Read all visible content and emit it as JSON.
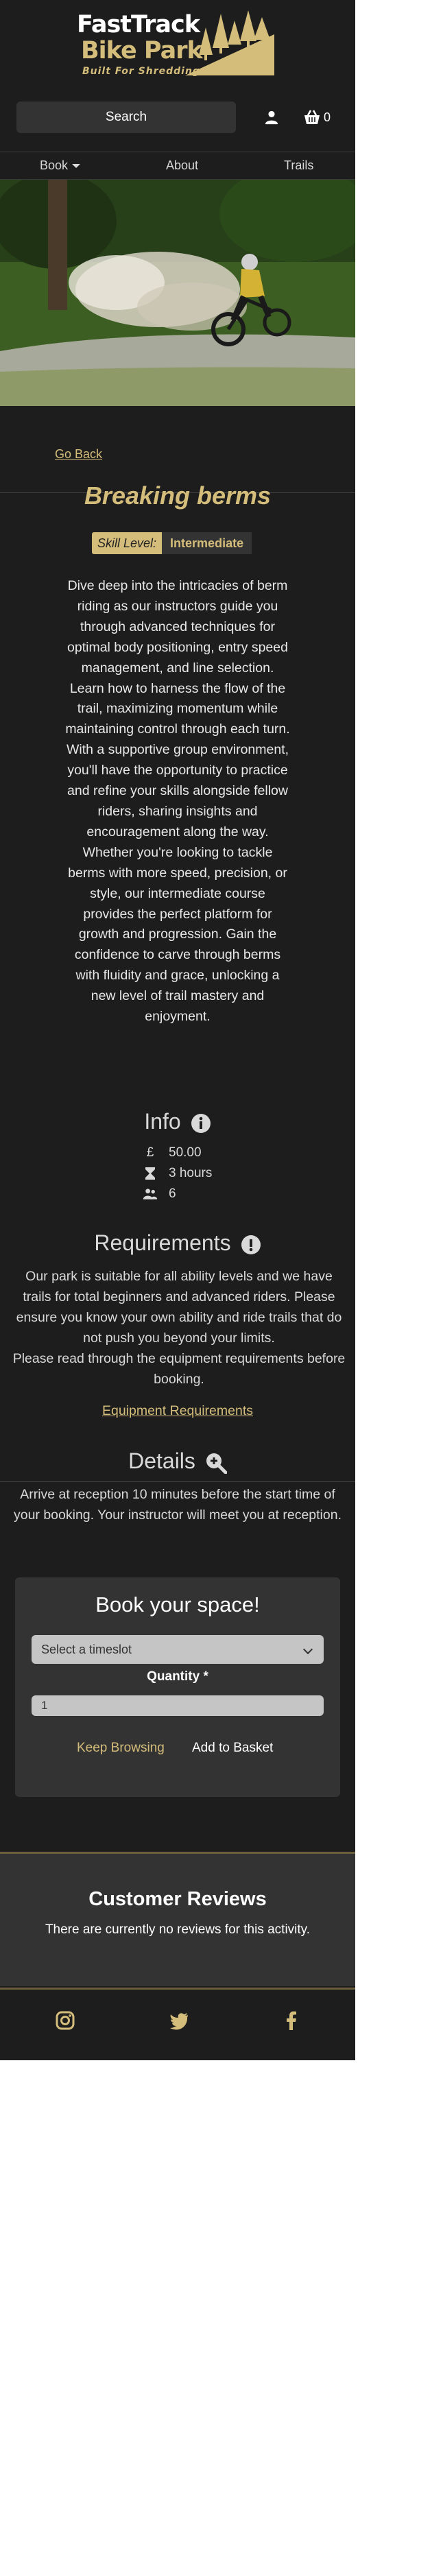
{
  "header": {
    "logo_line1": "FastTrack",
    "logo_line2": "Bike Park",
    "logo_tagline": "Built For Shredding",
    "search_label": "Search",
    "basket_count": "0"
  },
  "nav": {
    "book": "Book",
    "about": "About",
    "trails": "Trails"
  },
  "activity": {
    "go_back": "Go Back",
    "title": "Breaking berms",
    "skill_label": "Skill Level:",
    "skill_value": "Intermediate",
    "description": "Dive deep into the intricacies of berm riding as our instructors guide you through advanced techniques for optimal body positioning, entry speed management, and line selection. Learn how to harness the flow of the trail, maximizing momentum while maintaining control through each turn. With a supportive group environment, you'll have the opportunity to practice and refine your skills alongside fellow riders, sharing insights and encouragement along the way. Whether you're looking to tackle berms with more speed, precision, or style, our intermediate course provides the perfect platform for growth and progression. Gain the confidence to carve through berms with fluidity and grace, unlocking a new level of trail mastery and enjoyment."
  },
  "info": {
    "heading": "Info",
    "price": "50.00",
    "duration": "3 hours",
    "capacity": "6"
  },
  "requirements": {
    "heading": "Requirements",
    "text_1": "Our park is suitable for all ability levels and we have trails for total beginners and advanced riders. Please ensure you know your own ability and ride trails that do not push you beyond your limits.",
    "text_2": "Please read through the equipment requirements before booking.",
    "equipment_link": "Equipment Requirements"
  },
  "details": {
    "heading": "Details",
    "text": "Arrive at reception 10 minutes before the start time of your booking. Your instructor will meet you at reception."
  },
  "booking": {
    "title": "Book your space!",
    "timeslot_placeholder": "Select a timeslot",
    "quantity_label": "Quantity *",
    "quantity_value": "1",
    "keep_browsing": "Keep Browsing",
    "add_to_basket": "Add to Basket"
  },
  "reviews": {
    "title": "Customer Reviews",
    "empty_text": "There are currently no reviews for this activity."
  },
  "colors": {
    "background": "#1d1d1d",
    "accent_gold": "#d4bd7a",
    "card": "#333333"
  },
  "icons": {
    "user": "user-icon",
    "basket": "basket-icon",
    "info": "info-icon",
    "pound": "pound-icon",
    "hourglass": "hourglass-icon",
    "people": "people-icon",
    "exclamation": "exclamation-icon",
    "magnify_plus": "zoom-in-icon",
    "instagram": "instagram-icon",
    "twitter": "twitter-icon",
    "facebook": "facebook-icon"
  }
}
